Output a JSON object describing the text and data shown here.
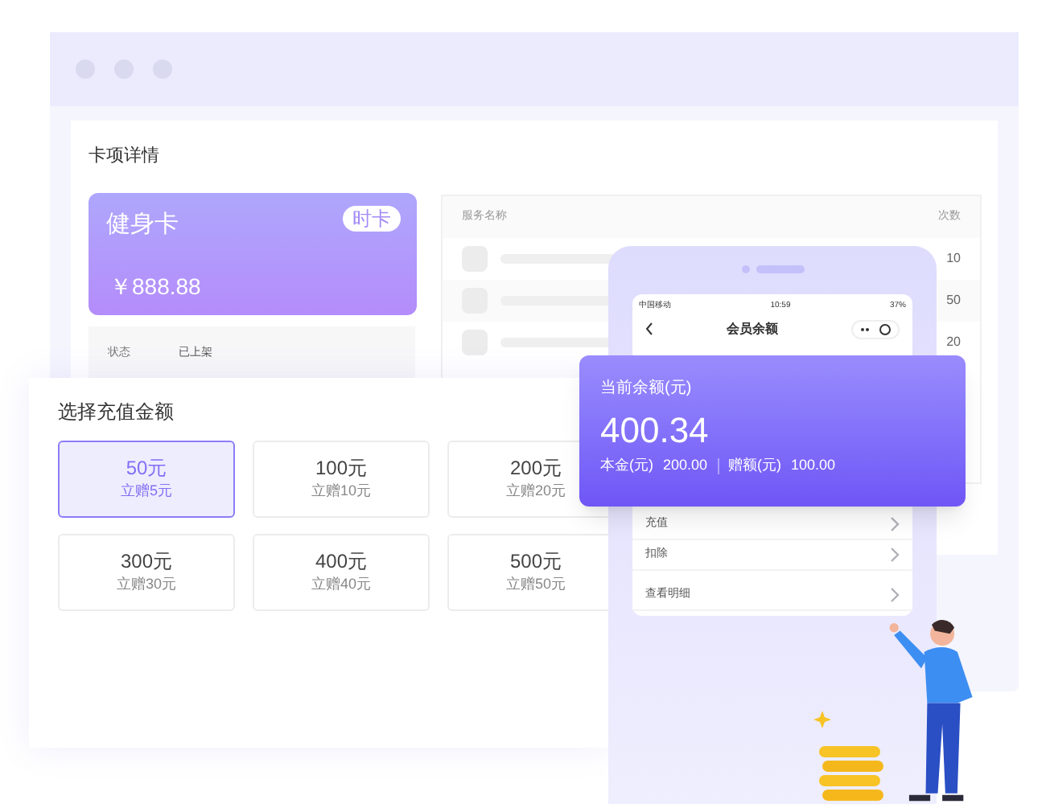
{
  "detail": {
    "title": "卡项详情",
    "card": {
      "name": "健身卡",
      "tag": "时卡",
      "amount": "￥888.88"
    },
    "info": [
      {
        "label": "状态",
        "value": "已上架"
      }
    ],
    "table": {
      "columns": [
        "服务名称",
        "次数"
      ],
      "rows": [
        {
          "count": "10"
        },
        {
          "count": "50"
        },
        {
          "count": "20"
        }
      ]
    }
  },
  "phone": {
    "status": {
      "carrier": "中国移动",
      "time": "10:59",
      "battery": "37%"
    },
    "title": "会员余额",
    "menu": [
      "充值",
      "扣除",
      "查看明细"
    ]
  },
  "balance": {
    "label": "当前余额(元)",
    "amount": "400.34",
    "principal_label": "本金(元)",
    "principal": "200.00",
    "bonus_label": "赠额(元)",
    "bonus": "100.00"
  },
  "recharge": {
    "title": "选择充值金额",
    "options": [
      {
        "amount": "50元",
        "bonus": "立赠5元",
        "selected": true
      },
      {
        "amount": "100元",
        "bonus": "立赠10元",
        "selected": false
      },
      {
        "amount": "200元",
        "bonus": "立赠20元",
        "selected": false
      },
      {
        "amount": "300元",
        "bonus": "立赠30元",
        "selected": false
      },
      {
        "amount": "400元",
        "bonus": "立赠40元",
        "selected": false
      },
      {
        "amount": "500元",
        "bonus": "立赠50元",
        "selected": false
      }
    ]
  }
}
